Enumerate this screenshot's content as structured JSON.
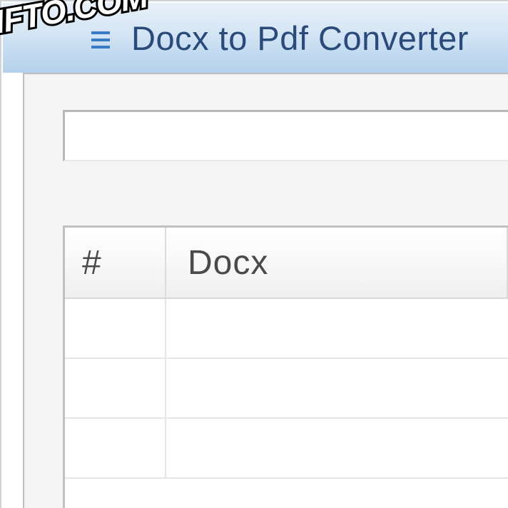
{
  "window": {
    "title": "Docx to Pdf Converter"
  },
  "input": {
    "value": ""
  },
  "table": {
    "columns": {
      "num": "#",
      "docx": "Docx"
    },
    "rows": [
      {
        "num": "",
        "docx": ""
      },
      {
        "num": "",
        "docx": ""
      },
      {
        "num": "",
        "docx": ""
      }
    ]
  },
  "watermark": {
    "text": "XIFTO.COM"
  }
}
